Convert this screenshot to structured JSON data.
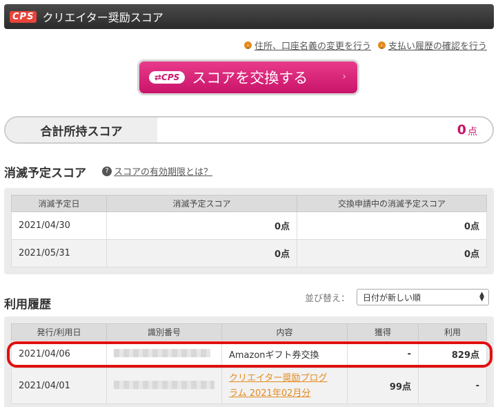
{
  "header": {
    "logo": "CPS",
    "title": "クリエイター奨励スコア"
  },
  "links": [
    {
      "label": "住所、口座名義の変更を行う"
    },
    {
      "label": "支払い履歴の確認を行う"
    }
  ],
  "exchange_button": {
    "logo": "⇄CPS",
    "label": "スコアを交換する",
    "arrow": "›"
  },
  "total": {
    "label": "合計所持スコア",
    "value": "0",
    "unit": "点"
  },
  "expiry": {
    "title": "消滅予定スコア",
    "help_link": "スコアの有効期限とは？",
    "columns": [
      "消滅予定日",
      "消滅予定スコア",
      "交換申請中の消滅予定スコア"
    ],
    "rows": [
      {
        "date": "2021/04/30",
        "score": "0点",
        "pending": "0点"
      },
      {
        "date": "2021/05/31",
        "score": "0点",
        "pending": "0点"
      }
    ]
  },
  "history": {
    "title": "利用履歴",
    "sort_label": "並び替え：",
    "sort_value": "日付が新しい順",
    "columns": [
      "発行/利用日",
      "識別番号",
      "内容",
      "獲得",
      "利用"
    ],
    "rows": [
      {
        "date": "2021/04/06",
        "content": "Amazonギフト券交換",
        "earned": "-",
        "used": "829点"
      },
      {
        "date": "2021/04/01",
        "content_line1": "クリエイター奨励プログ",
        "content_line2": "ラム 2021年02月分",
        "earned": "99点",
        "used": "-"
      }
    ]
  },
  "colors": {
    "accent": "#c9146a",
    "link_orange": "#e38a1d",
    "highlight": "#e01010"
  }
}
